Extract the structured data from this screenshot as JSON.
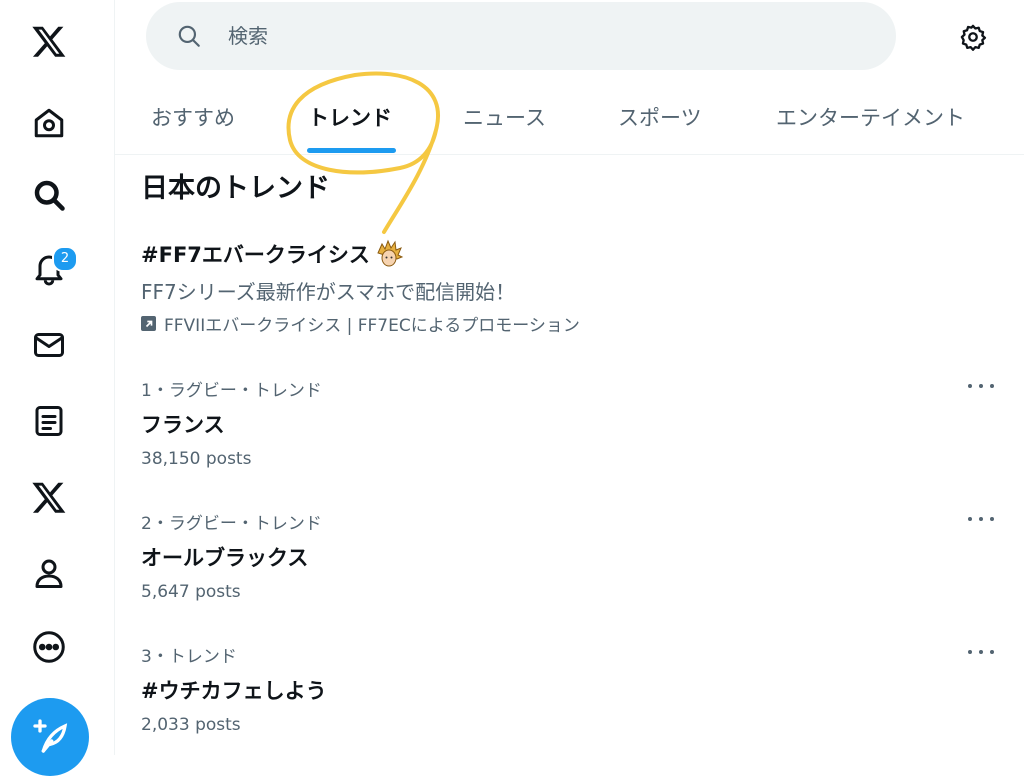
{
  "search": {
    "placeholder": "検索"
  },
  "tabs": [
    {
      "label": "おすすめ"
    },
    {
      "label": "トレンド"
    },
    {
      "label": "ニュース"
    },
    {
      "label": "スポーツ"
    },
    {
      "label": "エンターテイメント"
    }
  ],
  "active_tab": "トレンド",
  "nav": {
    "items": [
      "x-logo-icon",
      "home-icon",
      "explore-icon",
      "notifications-icon",
      "messages-icon",
      "lists-icon",
      "premium-icon",
      "profile-icon",
      "more-icon"
    ],
    "notification_badge": "2"
  },
  "section": {
    "title": "日本のトレンド"
  },
  "promoted": {
    "title": "#FF7エバークライシス",
    "description": "FF7シリーズ最新作がスマホで配信開始！",
    "by": "FFVIIエバークライシス | FF7ECによるプロモーション"
  },
  "trends": [
    {
      "meta": "1・ラグビー・トレンド",
      "name": "フランス",
      "count": "38,150 posts"
    },
    {
      "meta": "2・ラグビー・トレンド",
      "name": "オールブラックス",
      "count": "5,647 posts"
    },
    {
      "meta": "3・トレンド",
      "name": "#ウチカフェしよう",
      "count": "2,033 posts"
    }
  ],
  "colors": {
    "accent": "#1d9bf0",
    "highlight": "#f5c842",
    "text": "#0f1419",
    "secondary": "#536471"
  }
}
